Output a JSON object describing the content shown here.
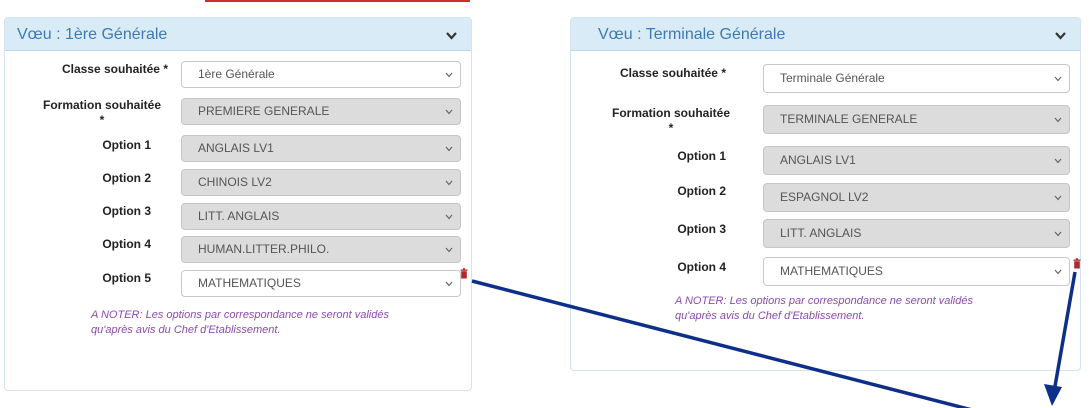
{
  "left": {
    "title": "Vœu : 1ère Générale",
    "classe": {
      "label": "Classe souhaitée *",
      "value": "1ère Générale"
    },
    "formation": {
      "label1": "Formation souhaitée",
      "label2": "*",
      "value": "PREMIERE GENERALE"
    },
    "options": [
      {
        "label": "Option 1",
        "value": "ANGLAIS LV1"
      },
      {
        "label": "Option 2",
        "value": "CHINOIS LV2"
      },
      {
        "label": "Option 3",
        "value": "LITT. ANGLAIS"
      },
      {
        "label": "Option 4",
        "value": "HUMAN.LITTER.PHILO."
      },
      {
        "label": "Option 5",
        "value": "MATHEMATIQUES"
      }
    ],
    "note1": "A NOTER: Les options par correspondance ne seront validés",
    "note2": "qu'après avis du Chef d'Etablissement."
  },
  "right": {
    "title": "Vœu : Terminale Générale",
    "classe": {
      "label": "Classe souhaitée *",
      "value": "Terminale Générale"
    },
    "formation": {
      "label1": "Formation souhaitée",
      "label2": "*",
      "value": "TERMINALE GENERALE"
    },
    "options": [
      {
        "label": "Option 1",
        "value": "ANGLAIS LV1"
      },
      {
        "label": "Option 2",
        "value": "ESPAGNOL LV2"
      },
      {
        "label": "Option 3",
        "value": "LITT. ANGLAIS"
      },
      {
        "label": "Option 4",
        "value": "MATHEMATIQUES"
      }
    ],
    "note1": "A NOTER: Les options par correspondance ne seront validés",
    "note2": "qu'après avis du Chef d'Etablissement."
  },
  "colors": {
    "header_bg": "#d9ebf7",
    "title": "#3b7ab5",
    "note": "#8a4baf",
    "arrow": "#0d2f8a",
    "trash": "#b02a2a"
  }
}
